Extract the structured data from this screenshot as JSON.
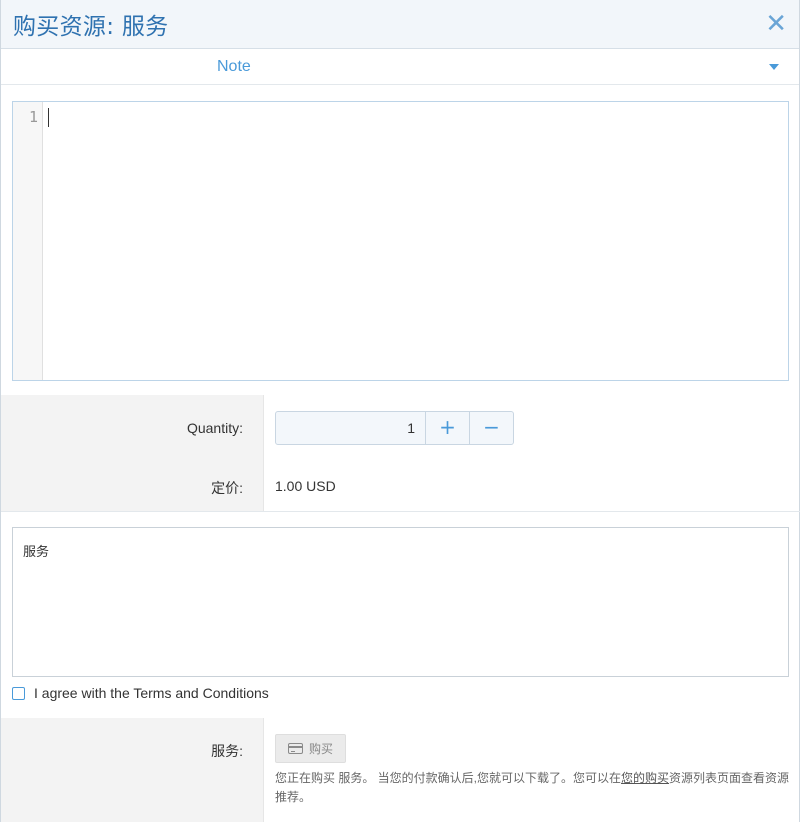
{
  "dialog": {
    "title": "购买资源: 服务",
    "close_glyph": "✕"
  },
  "note": {
    "label": "Note"
  },
  "editor": {
    "line_number": "1",
    "content": ""
  },
  "form": {
    "quantity_label": "Quantity:",
    "quantity_value": "1",
    "plus_glyph": "+",
    "minus_glyph": "−",
    "price_label": "定价:",
    "price_value": "1.00 USD"
  },
  "description": {
    "text": "服务"
  },
  "terms": {
    "label": "I agree with the Terms and Conditions",
    "checked": false
  },
  "purchase": {
    "label": "服务:",
    "button_label": "购买",
    "button_icon": "credit-card-icon",
    "info_before": "您正在购买 服务。 当您的付款确认后,您就可以下载了。您可以在",
    "info_link": "您的购买",
    "info_after": "资源列表页面查看资源推荐。"
  },
  "colors": {
    "accent": "#4a9ad9",
    "title": "#2f72b0",
    "label_bg": "#f3f3f3"
  }
}
